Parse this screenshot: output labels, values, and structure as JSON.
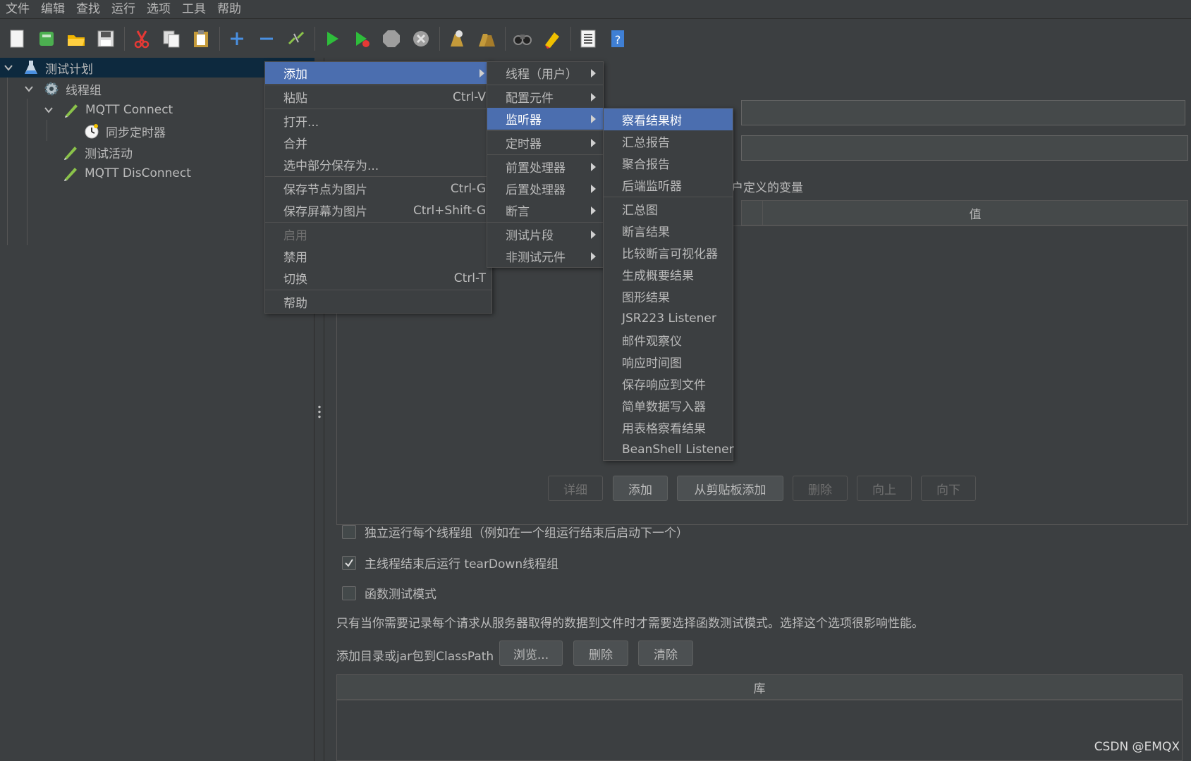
{
  "menubar": [
    "文件",
    "编辑",
    "查找",
    "运行",
    "选项",
    "工具",
    "帮助"
  ],
  "toolbar": {
    "icons": [
      "new-icon",
      "templates-icon",
      "open-icon",
      "save-icon",
      "cut-icon",
      "copy-icon",
      "paste-icon",
      "expand-icon",
      "collapse-icon",
      "toggle-icon",
      "start-icon",
      "start-no-pause-icon",
      "stop-icon",
      "shutdown-icon",
      "clear-icon",
      "clear-all-icon",
      "search-icon",
      "reset-search-icon",
      "function-helper-icon",
      "help-icon"
    ]
  },
  "tree": {
    "items": [
      {
        "label": "测试计划"
      },
      {
        "label": "线程组"
      },
      {
        "label": "MQTT Connect"
      },
      {
        "label": "同步定时器"
      },
      {
        "label": "测试活动"
      },
      {
        "label": "MQTT DisConnect"
      }
    ]
  },
  "context_menu": {
    "items": [
      {
        "label": "添加",
        "shortcut": ""
      },
      {
        "label": "粘贴",
        "shortcut": "Ctrl-V"
      },
      {
        "label": "打开...",
        "shortcut": ""
      },
      {
        "label": "合并",
        "shortcut": ""
      },
      {
        "label": "选中部分保存为...",
        "shortcut": ""
      },
      {
        "label": "保存节点为图片",
        "shortcut": "Ctrl-G"
      },
      {
        "label": "保存屏幕为图片",
        "shortcut": "Ctrl+Shift-G"
      },
      {
        "label": "启用",
        "shortcut": ""
      },
      {
        "label": "禁用",
        "shortcut": ""
      },
      {
        "label": "切换",
        "shortcut": "Ctrl-T"
      },
      {
        "label": "帮助",
        "shortcut": ""
      }
    ]
  },
  "add_submenu": {
    "items": [
      "线程（用户）",
      "配置元件",
      "监听器",
      "定时器",
      "前置处理器",
      "后置处理器",
      "断言",
      "测试片段",
      "非测试元件"
    ]
  },
  "listener_submenu": {
    "items": [
      "察看结果树",
      "汇总报告",
      "聚合报告",
      "后端监听器",
      "汇总图",
      "断言结果",
      "比较断言可视化器",
      "生成概要结果",
      "图形结果",
      "JSR223 Listener",
      "邮件观察仪",
      "响应时间图",
      "保存响应到文件",
      "简单数据写入器",
      "用表格察看结果",
      "BeanShell Listener"
    ]
  },
  "panel": {
    "user_vars_label": "户定义的变量",
    "value_header": "值",
    "buttons": {
      "detail": "详细",
      "add": "添加",
      "add_from_clipboard": "从剪贴板添加",
      "delete": "删除",
      "up": "向上",
      "down": "向下"
    },
    "checkbox_serialize": "独立运行每个线程组（例如在一个组运行结束后启动下一个）",
    "checkbox_teardown": "主线程结束后运行 tearDown线程组",
    "checkbox_functional": "函数测试模式",
    "functional_note": "只有当你需要记录每个请求从服务器取得的数据到文件时才需要选择函数测试模式。选择这个选项很影响性能。",
    "classpath_label": "添加目录或jar包到ClassPath",
    "browse": "浏览...",
    "remove": "删除",
    "clear": "清除",
    "library_header": "库"
  },
  "watermark": "CSDN @EMQX"
}
